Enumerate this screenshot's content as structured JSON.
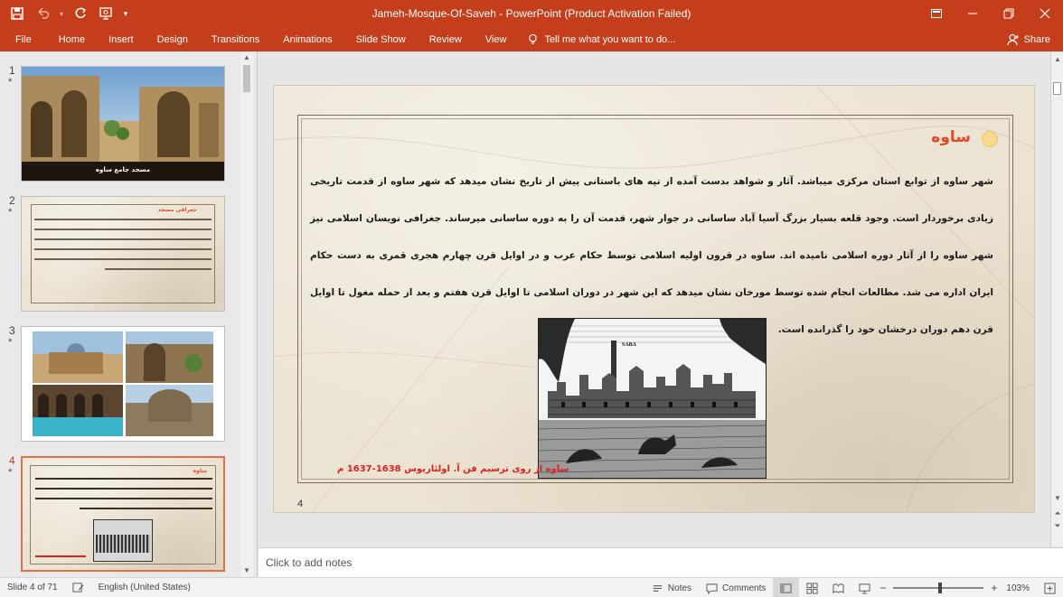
{
  "window": {
    "title": "Jameh-Mosque-Of-Saveh - PowerPoint (Product Activation Failed)"
  },
  "ribbon": {
    "tabs": [
      "File",
      "Home",
      "Insert",
      "Design",
      "Transitions",
      "Animations",
      "Slide Show",
      "Review",
      "View"
    ],
    "tell_me": "Tell me what you want to do...",
    "share": "Share"
  },
  "thumbnails": [
    {
      "number": "1",
      "star": "*",
      "caption": "مسجد جامع ساوه"
    },
    {
      "number": "2",
      "star": "*",
      "title": "جغرافی مسجد"
    },
    {
      "number": "3",
      "star": "*"
    },
    {
      "number": "4",
      "star": "*",
      "title": "ساوه"
    }
  ],
  "slide": {
    "title": "ساوه",
    "paragraph": "شهر ساوه از توابع استان مرکزی میباشد. آثار و شواهد بدست آمده از تپه های باستانی پیش از تاریخ نشان میدهد که شهر ساوه از قدمت تاریخی زیادی برخوردار است. وجود قلعه بسیار بزرگ آسیا آباد ساسانی در جوار شهر، قدمت آن را به دوره ساسانی میرساند. جغرافی نویسان اسلامی نیز شهر ساوه را از آثار دوره اسلامی نامیده اند.  ساوه در قرون اولیه اسلامی توسط حکام عرب و در اوایل قرن چهارم هجری قمری به دست حکام ایران اداره می شد. مطالعات انجام شده توسط مورخان نشان میدهد که این شهر در دوران اسلامی تا اوایل قرن هفتم و بعد از حمله مغول تا اوایل قرن دهم دوران درخشان خود را گذرانده است.",
    "image_label": "SABA",
    "caption": "ساوه از روی ترسیم فن آ. اولئاریوس 1638-1637 م",
    "number": "4"
  },
  "notes": {
    "placeholder": "Click to add notes"
  },
  "status": {
    "slide_of": "Slide 4 of 71",
    "language": "English (United States)",
    "notes": "Notes",
    "comments": "Comments",
    "zoom": "103%"
  },
  "colors": {
    "accent": "#c43e1c",
    "title_red": "#e04a2a",
    "caption_red": "#e02020",
    "parchment": "#ece4d3"
  }
}
